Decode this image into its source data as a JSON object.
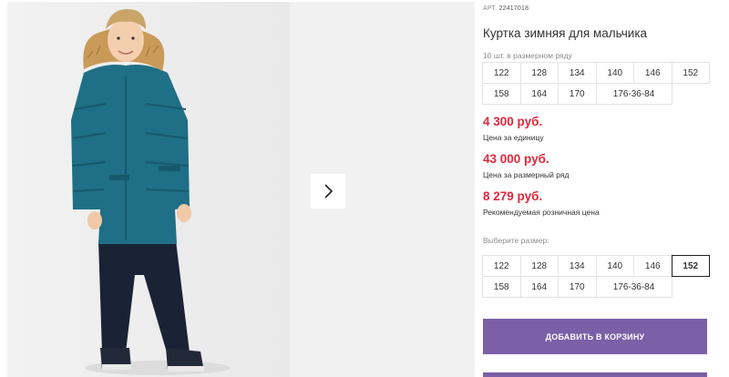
{
  "product": {
    "sku_label": "АРТ.",
    "sku_value": "22417018",
    "title": "Куртка зимняя для мальчика",
    "row_caption": "10 шт. в размерном ряду",
    "row_sizes": [
      "122",
      "128",
      "134",
      "140",
      "146",
      "152",
      "158",
      "164",
      "170",
      "176-36-84"
    ]
  },
  "prices": [
    {
      "value": "4 300 руб.",
      "label": "Цена за единицу"
    },
    {
      "value": "43 000 руб.",
      "label": "Цена за размерный ряд"
    },
    {
      "value": "8 279 руб.",
      "label": "Рекомендуемая розничная цена"
    }
  ],
  "size_picker": {
    "caption": "Выберите размер:",
    "sizes": [
      "122",
      "128",
      "134",
      "140",
      "146",
      "152",
      "158",
      "164",
      "170",
      "176-36-84"
    ],
    "selected": "152"
  },
  "actions": {
    "add_to_cart": "ДОБАВИТЬ В КОРЗИНУ"
  },
  "colors": {
    "price": "#e2273a",
    "button": "#7b5fa7",
    "jacket": "#1f6f86",
    "fur": "#c99a58",
    "pants": "#1a2336"
  },
  "icons": {
    "gallery_next": "chevron-right-icon"
  }
}
